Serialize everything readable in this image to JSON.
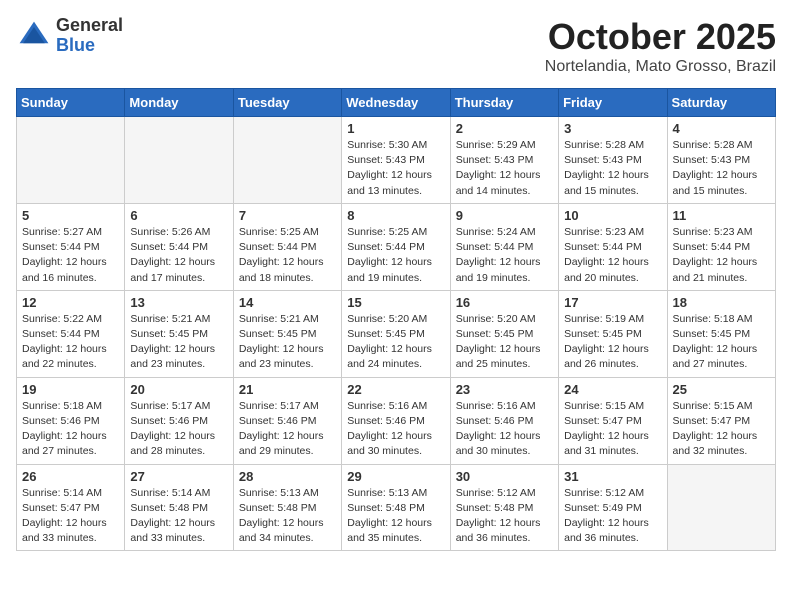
{
  "header": {
    "logo_line1": "General",
    "logo_line2": "Blue",
    "month": "October 2025",
    "location": "Nortelandia, Mato Grosso, Brazil"
  },
  "days_of_week": [
    "Sunday",
    "Monday",
    "Tuesday",
    "Wednesday",
    "Thursday",
    "Friday",
    "Saturday"
  ],
  "weeks": [
    [
      {
        "day": "",
        "info": ""
      },
      {
        "day": "",
        "info": ""
      },
      {
        "day": "",
        "info": ""
      },
      {
        "day": "1",
        "info": "Sunrise: 5:30 AM\nSunset: 5:43 PM\nDaylight: 12 hours\nand 13 minutes."
      },
      {
        "day": "2",
        "info": "Sunrise: 5:29 AM\nSunset: 5:43 PM\nDaylight: 12 hours\nand 14 minutes."
      },
      {
        "day": "3",
        "info": "Sunrise: 5:28 AM\nSunset: 5:43 PM\nDaylight: 12 hours\nand 15 minutes."
      },
      {
        "day": "4",
        "info": "Sunrise: 5:28 AM\nSunset: 5:43 PM\nDaylight: 12 hours\nand 15 minutes."
      }
    ],
    [
      {
        "day": "5",
        "info": "Sunrise: 5:27 AM\nSunset: 5:44 PM\nDaylight: 12 hours\nand 16 minutes."
      },
      {
        "day": "6",
        "info": "Sunrise: 5:26 AM\nSunset: 5:44 PM\nDaylight: 12 hours\nand 17 minutes."
      },
      {
        "day": "7",
        "info": "Sunrise: 5:25 AM\nSunset: 5:44 PM\nDaylight: 12 hours\nand 18 minutes."
      },
      {
        "day": "8",
        "info": "Sunrise: 5:25 AM\nSunset: 5:44 PM\nDaylight: 12 hours\nand 19 minutes."
      },
      {
        "day": "9",
        "info": "Sunrise: 5:24 AM\nSunset: 5:44 PM\nDaylight: 12 hours\nand 19 minutes."
      },
      {
        "day": "10",
        "info": "Sunrise: 5:23 AM\nSunset: 5:44 PM\nDaylight: 12 hours\nand 20 minutes."
      },
      {
        "day": "11",
        "info": "Sunrise: 5:23 AM\nSunset: 5:44 PM\nDaylight: 12 hours\nand 21 minutes."
      }
    ],
    [
      {
        "day": "12",
        "info": "Sunrise: 5:22 AM\nSunset: 5:44 PM\nDaylight: 12 hours\nand 22 minutes."
      },
      {
        "day": "13",
        "info": "Sunrise: 5:21 AM\nSunset: 5:45 PM\nDaylight: 12 hours\nand 23 minutes."
      },
      {
        "day": "14",
        "info": "Sunrise: 5:21 AM\nSunset: 5:45 PM\nDaylight: 12 hours\nand 23 minutes."
      },
      {
        "day": "15",
        "info": "Sunrise: 5:20 AM\nSunset: 5:45 PM\nDaylight: 12 hours\nand 24 minutes."
      },
      {
        "day": "16",
        "info": "Sunrise: 5:20 AM\nSunset: 5:45 PM\nDaylight: 12 hours\nand 25 minutes."
      },
      {
        "day": "17",
        "info": "Sunrise: 5:19 AM\nSunset: 5:45 PM\nDaylight: 12 hours\nand 26 minutes."
      },
      {
        "day": "18",
        "info": "Sunrise: 5:18 AM\nSunset: 5:45 PM\nDaylight: 12 hours\nand 27 minutes."
      }
    ],
    [
      {
        "day": "19",
        "info": "Sunrise: 5:18 AM\nSunset: 5:46 PM\nDaylight: 12 hours\nand 27 minutes."
      },
      {
        "day": "20",
        "info": "Sunrise: 5:17 AM\nSunset: 5:46 PM\nDaylight: 12 hours\nand 28 minutes."
      },
      {
        "day": "21",
        "info": "Sunrise: 5:17 AM\nSunset: 5:46 PM\nDaylight: 12 hours\nand 29 minutes."
      },
      {
        "day": "22",
        "info": "Sunrise: 5:16 AM\nSunset: 5:46 PM\nDaylight: 12 hours\nand 30 minutes."
      },
      {
        "day": "23",
        "info": "Sunrise: 5:16 AM\nSunset: 5:46 PM\nDaylight: 12 hours\nand 30 minutes."
      },
      {
        "day": "24",
        "info": "Sunrise: 5:15 AM\nSunset: 5:47 PM\nDaylight: 12 hours\nand 31 minutes."
      },
      {
        "day": "25",
        "info": "Sunrise: 5:15 AM\nSunset: 5:47 PM\nDaylight: 12 hours\nand 32 minutes."
      }
    ],
    [
      {
        "day": "26",
        "info": "Sunrise: 5:14 AM\nSunset: 5:47 PM\nDaylight: 12 hours\nand 33 minutes."
      },
      {
        "day": "27",
        "info": "Sunrise: 5:14 AM\nSunset: 5:48 PM\nDaylight: 12 hours\nand 33 minutes."
      },
      {
        "day": "28",
        "info": "Sunrise: 5:13 AM\nSunset: 5:48 PM\nDaylight: 12 hours\nand 34 minutes."
      },
      {
        "day": "29",
        "info": "Sunrise: 5:13 AM\nSunset: 5:48 PM\nDaylight: 12 hours\nand 35 minutes."
      },
      {
        "day": "30",
        "info": "Sunrise: 5:12 AM\nSunset: 5:48 PM\nDaylight: 12 hours\nand 36 minutes."
      },
      {
        "day": "31",
        "info": "Sunrise: 5:12 AM\nSunset: 5:49 PM\nDaylight: 12 hours\nand 36 minutes."
      },
      {
        "day": "",
        "info": ""
      }
    ]
  ]
}
